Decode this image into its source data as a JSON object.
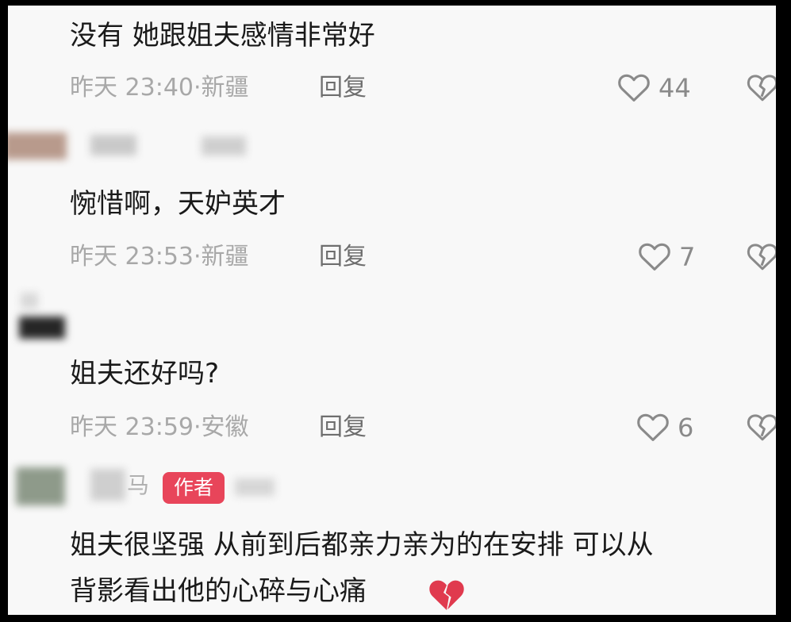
{
  "comments": [
    {
      "text": "没有 她跟姐夫感情非常好",
      "time": "昨天 23:40",
      "location": "新疆",
      "reply": "回复",
      "likes": "44"
    },
    {
      "text": "惋惜啊，天妒英才",
      "time": "昨天 23:53",
      "location": "新疆",
      "reply": "回复",
      "likes": "7"
    },
    {
      "text": "姐夫还好吗?",
      "time": "昨天 23:59",
      "location": "安徽",
      "reply": "回复",
      "likes": "6"
    }
  ],
  "author_comment": {
    "name_fragment": "马",
    "badge": "作者",
    "text_line1": "姐夫很坚强 从前到后都亲力亲为的在安排 可以从",
    "text_line2": "背影看出他的心碎与心痛"
  },
  "icons": {
    "like": "heart-outline-icon",
    "dislike": "broken-heart-outline-icon",
    "emoji": "broken-heart-emoji"
  },
  "colors": {
    "badge": "#e8455a",
    "emoji": "#e03a4e"
  }
}
